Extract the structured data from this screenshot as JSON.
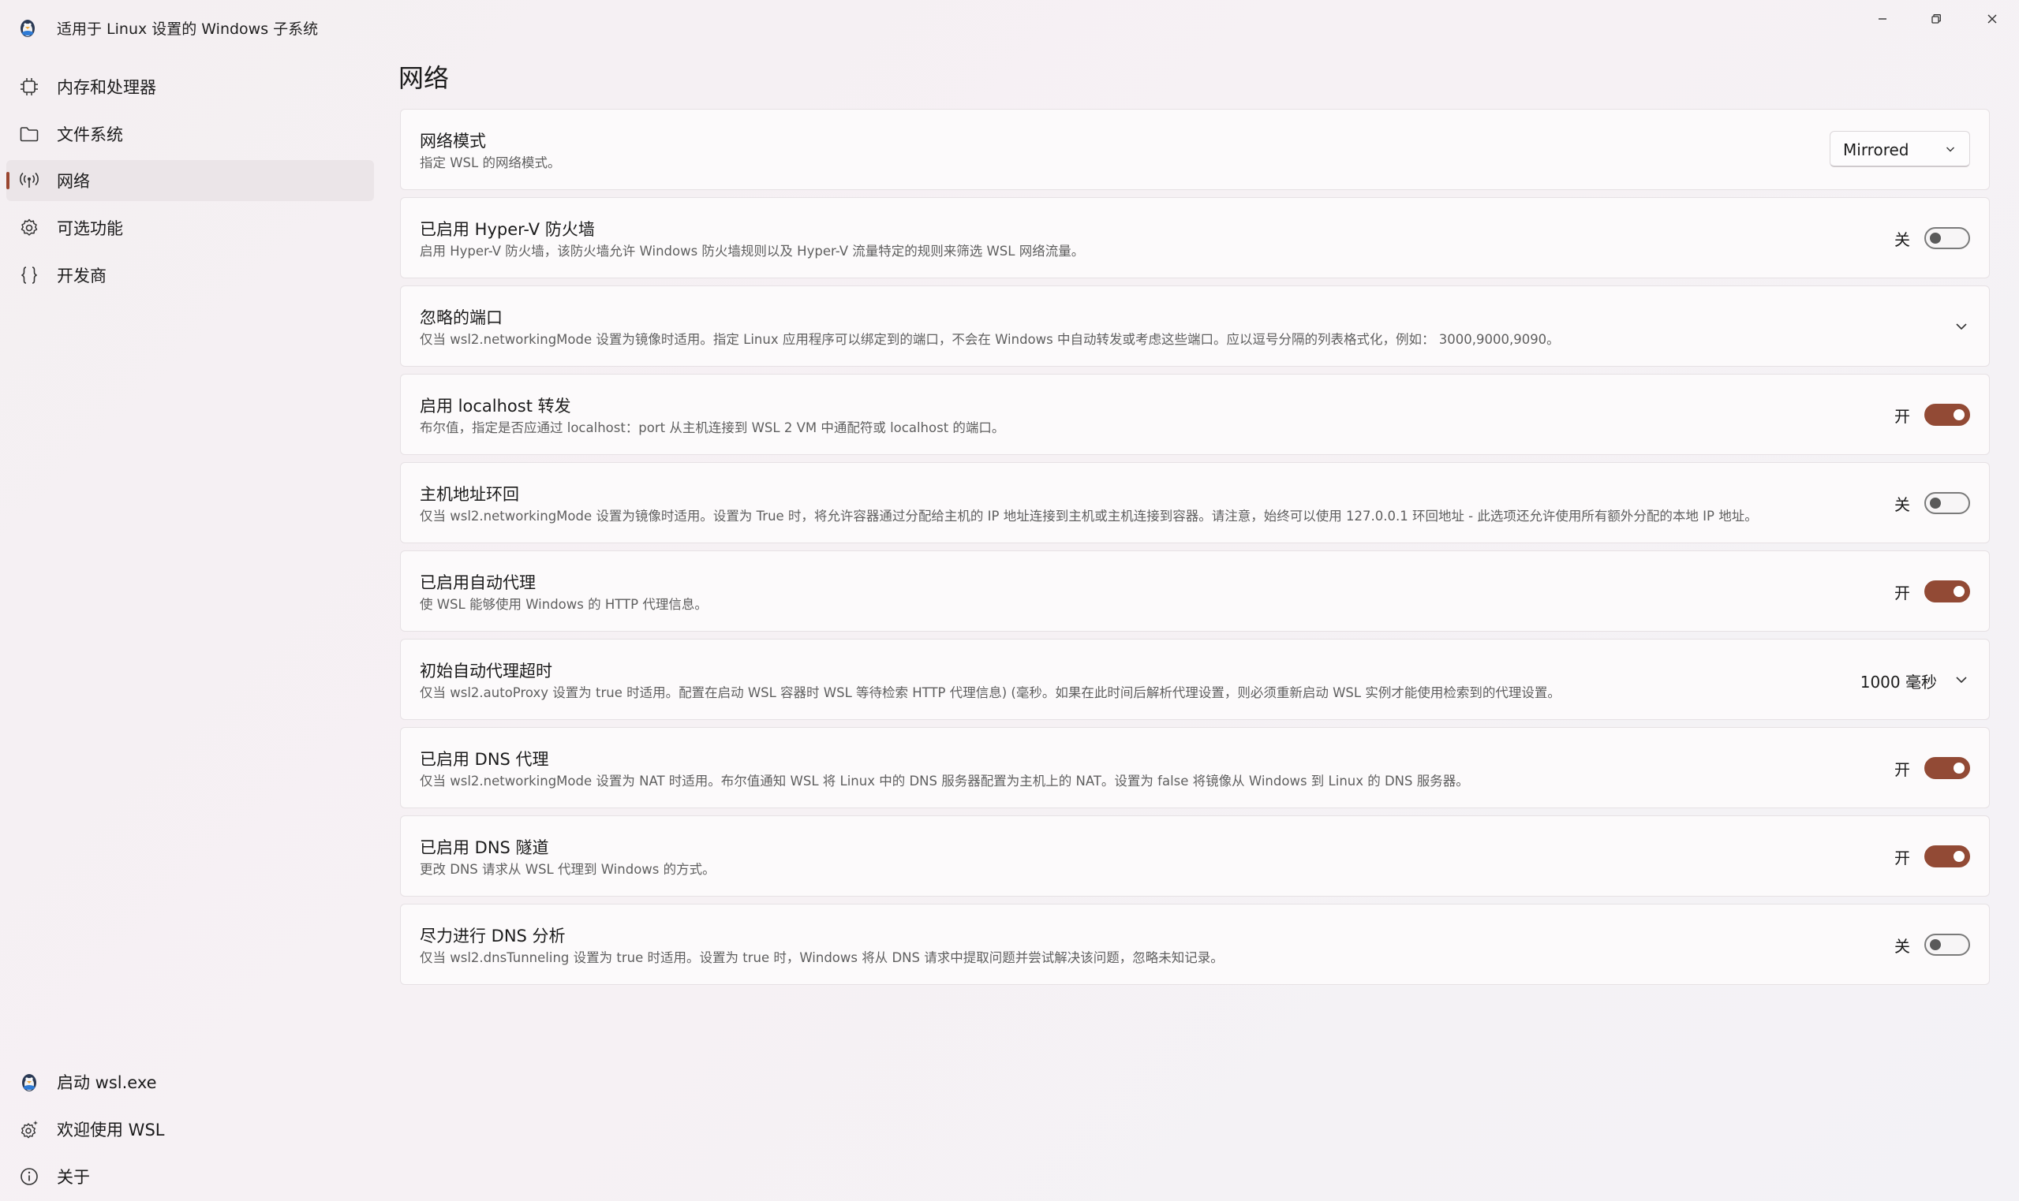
{
  "window": {
    "title": "适用于 Linux 设置的 Windows 子系统"
  },
  "sidebar": {
    "items": [
      {
        "label": "内存和处理器",
        "icon": "processor-icon"
      },
      {
        "label": "文件系统",
        "icon": "folder-icon"
      },
      {
        "label": "网络",
        "icon": "network-icon",
        "selected": true
      },
      {
        "label": "可选功能",
        "icon": "gear-icon"
      },
      {
        "label": "开发商",
        "icon": "braces-icon"
      }
    ],
    "footer": [
      {
        "label": "启动 wsl.exe",
        "icon": "penguin-icon"
      },
      {
        "label": "欢迎使用 WSL",
        "icon": "sparkle-gear-icon"
      },
      {
        "label": "关于",
        "icon": "info-icon"
      }
    ]
  },
  "page": {
    "title": "网络"
  },
  "settings": [
    {
      "title": "网络模式",
      "desc": "指定 WSL 的网络模式。",
      "control": "dropdown",
      "value": "Mirrored"
    },
    {
      "title": "已启用 Hyper-V 防火墙",
      "desc": "启用 Hyper-V 防火墙，该防火墙允许 Windows 防火墙规则以及 Hyper-V 流量特定的规则来筛选 WSL 网络流量。",
      "control": "toggle",
      "state_label": "关",
      "on": false
    },
    {
      "title": "忽略的端口",
      "desc": "仅当 wsl2.networkingMode 设置为镜像时适用。指定 Linux 应用程序可以绑定到的端口，不会在 Windows 中自动转发或考虑这些端口。应以逗号分隔的列表格式化，例如： 3000,9000,9090。",
      "control": "expander"
    },
    {
      "title": "启用 localhost 转发",
      "desc": "布尔值，指定是否应通过 localhost：port 从主机连接到 WSL 2 VM 中通配符或 localhost 的端口。",
      "control": "toggle",
      "state_label": "开",
      "on": true
    },
    {
      "title": "主机地址环回",
      "desc": "仅当 wsl2.networkingMode 设置为镜像时适用。设置为 True 时，将允许容器通过分配给主机的 IP 地址连接到主机或主机连接到容器。请注意，始终可以使用 127.0.0.1 环回地址 - 此选项还允许使用所有额外分配的本地 IP 地址。",
      "control": "toggle",
      "state_label": "关",
      "on": false
    },
    {
      "title": "已启用自动代理",
      "desc": "使 WSL 能够使用 Windows 的 HTTP 代理信息。",
      "control": "toggle",
      "state_label": "开",
      "on": true
    },
    {
      "title": "初始自动代理超时",
      "desc": "仅当 wsl2.autoProxy 设置为 true 时适用。配置在启动 WSL 容器时 WSL 等待检索 HTTP 代理信息) (毫秒。如果在此时间后解析代理设置，则必须重新启动 WSL 实例才能使用检索到的代理设置。",
      "control": "expander",
      "value": "1000 毫秒"
    },
    {
      "title": "已启用 DNS 代理",
      "desc": "仅当 wsl2.networkingMode 设置为 NAT 时适用。布尔值通知 WSL 将 Linux 中的 DNS 服务器配置为主机上的 NAT。设置为 false 将镜像从 Windows 到 Linux 的 DNS 服务器。",
      "control": "toggle",
      "state_label": "开",
      "on": true
    },
    {
      "title": "已启用 DNS 隧道",
      "desc": "更改 DNS 请求从 WSL 代理到 Windows 的方式。",
      "control": "toggle",
      "state_label": "开",
      "on": true
    },
    {
      "title": "尽力进行 DNS 分析",
      "desc": "仅当 wsl2.dnsTunneling 设置为 true 时适用。设置为 true 时，Windows 将从 DNS 请求中提取问题并尝试解决该问题，忽略未知记录。",
      "control": "toggle",
      "state_label": "关",
      "on": false
    }
  ],
  "colors": {
    "accent": "#924a35",
    "selected_nav_bg": "#ebe5e8",
    "card_bg": "#fcfafb"
  }
}
